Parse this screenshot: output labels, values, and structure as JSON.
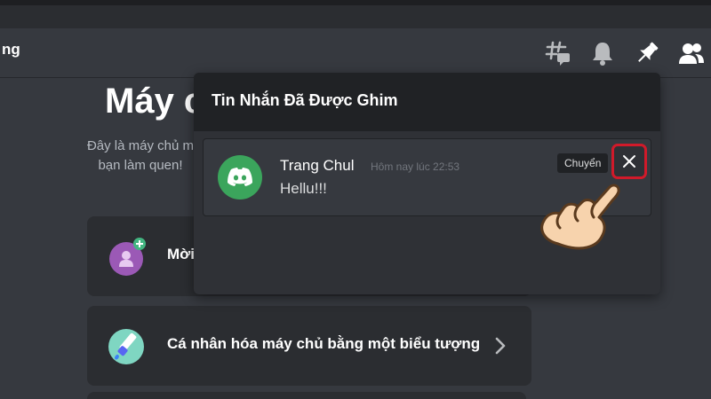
{
  "header": {
    "title": "ng",
    "icons": [
      "threads-icon",
      "bell-icon",
      "pin-icon",
      "members-icon"
    ]
  },
  "welcome": {
    "title": "Máy c",
    "description_line1": "Đây là máy chủ m",
    "description_line2": "bạn làm quen!"
  },
  "cards": [
    {
      "label": "Mời",
      "icon": "invite-friends-icon"
    },
    {
      "label": "Cá nhân hóa máy chủ bằng một biểu tượng",
      "icon": "paintbrush-icon"
    }
  ],
  "pins_popout": {
    "title": "Tin Nhắn Đã Được Ghim",
    "messages": [
      {
        "author": "Trang Chul",
        "timestamp": "Hôm nay lúc 22:53",
        "text": "Hellu!!!",
        "avatar_icon": "discord-logo-icon",
        "avatar_color": "#3ba55c",
        "jump_label": "Chuyển"
      }
    ]
  },
  "colors": {
    "background": "#36393f",
    "card": "#2b2d31",
    "popout": "#2f3136",
    "popout_header": "#202225",
    "highlight": "#d11a2a"
  }
}
